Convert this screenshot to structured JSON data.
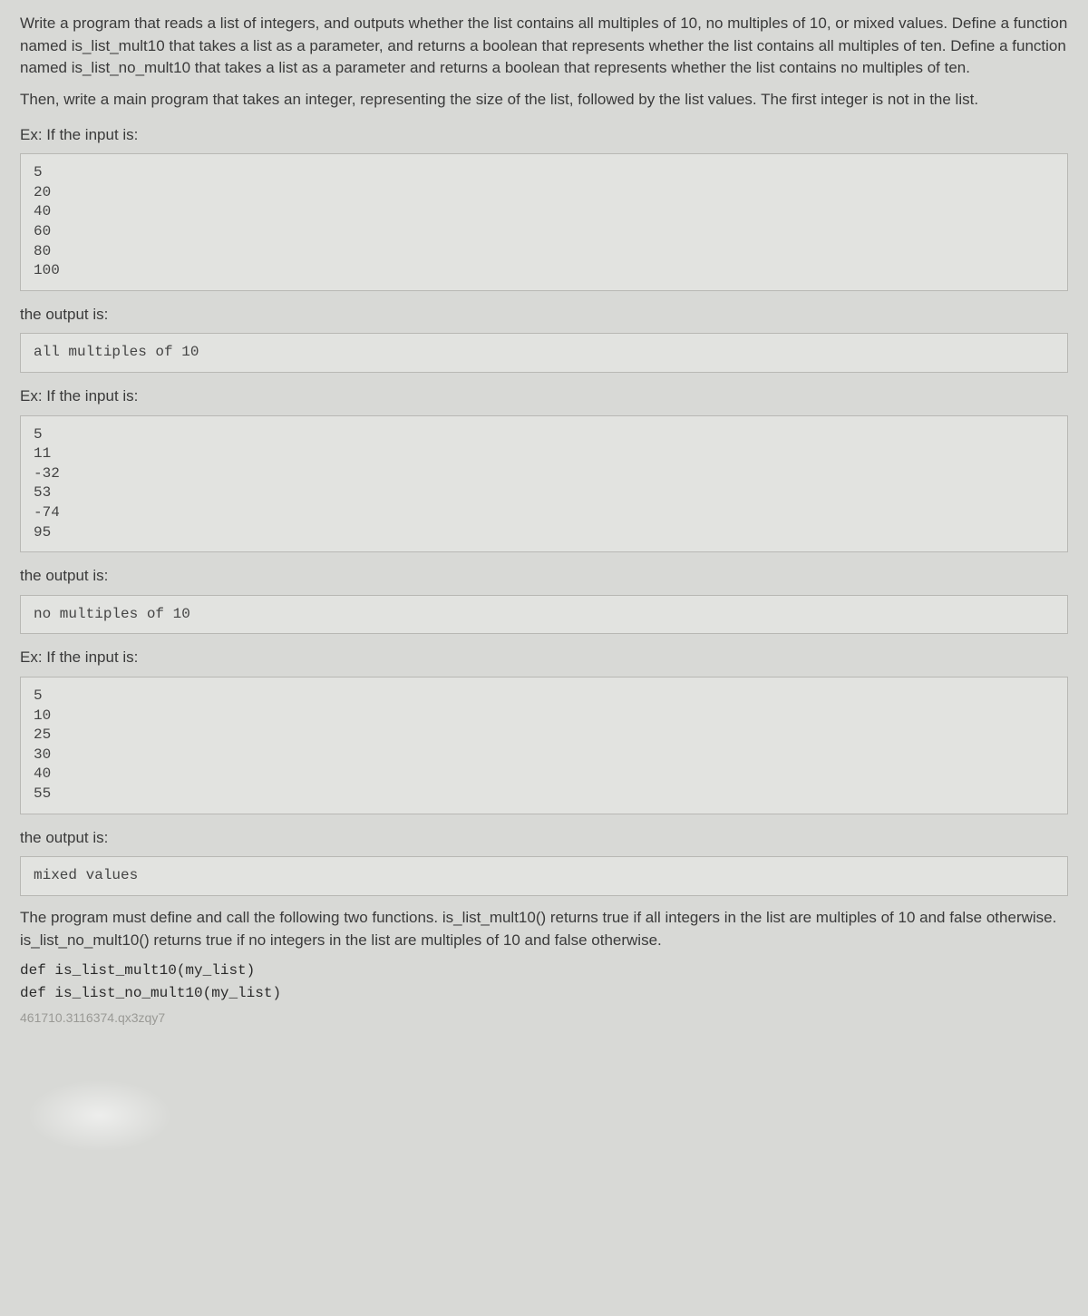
{
  "intro": {
    "p1": "Write a program that reads a list of integers, and outputs whether the list contains all multiples of 10, no multiples of 10, or mixed values. Define a function named is_list_mult10 that takes a list as a parameter, and returns a boolean that represents whether the list contains all multiples of ten. Define a function named is_list_no_mult10 that takes a list as a parameter and returns a boolean that represents whether the list contains no multiples of ten.",
    "p2": "Then, write a main program that takes an integer, representing the size of the list, followed by the list values. The first integer is not in the list."
  },
  "labels": {
    "ex_input": "Ex: If the input is:",
    "the_output": "the output is:"
  },
  "example1": {
    "input": "5\n20\n40\n60\n80\n100",
    "output": "all multiples of 10"
  },
  "example2": {
    "input": "5\n11\n-32\n53\n-74\n95",
    "output": "no multiples of 10"
  },
  "example3": {
    "input": "5\n10\n25\n30\n40\n55",
    "output": "mixed values"
  },
  "footer": {
    "desc": "The program must define and call the following two functions. is_list_mult10() returns true if all integers in the list are multiples of 10 and false otherwise. is_list_no_mult10() returns true if no integers in the list are multiples of 10 and false otherwise.",
    "sig1": "def is_list_mult10(my_list)",
    "sig2": "def is_list_no_mult10(my_list)",
    "id": "461710.3116374.qx3zqy7"
  }
}
